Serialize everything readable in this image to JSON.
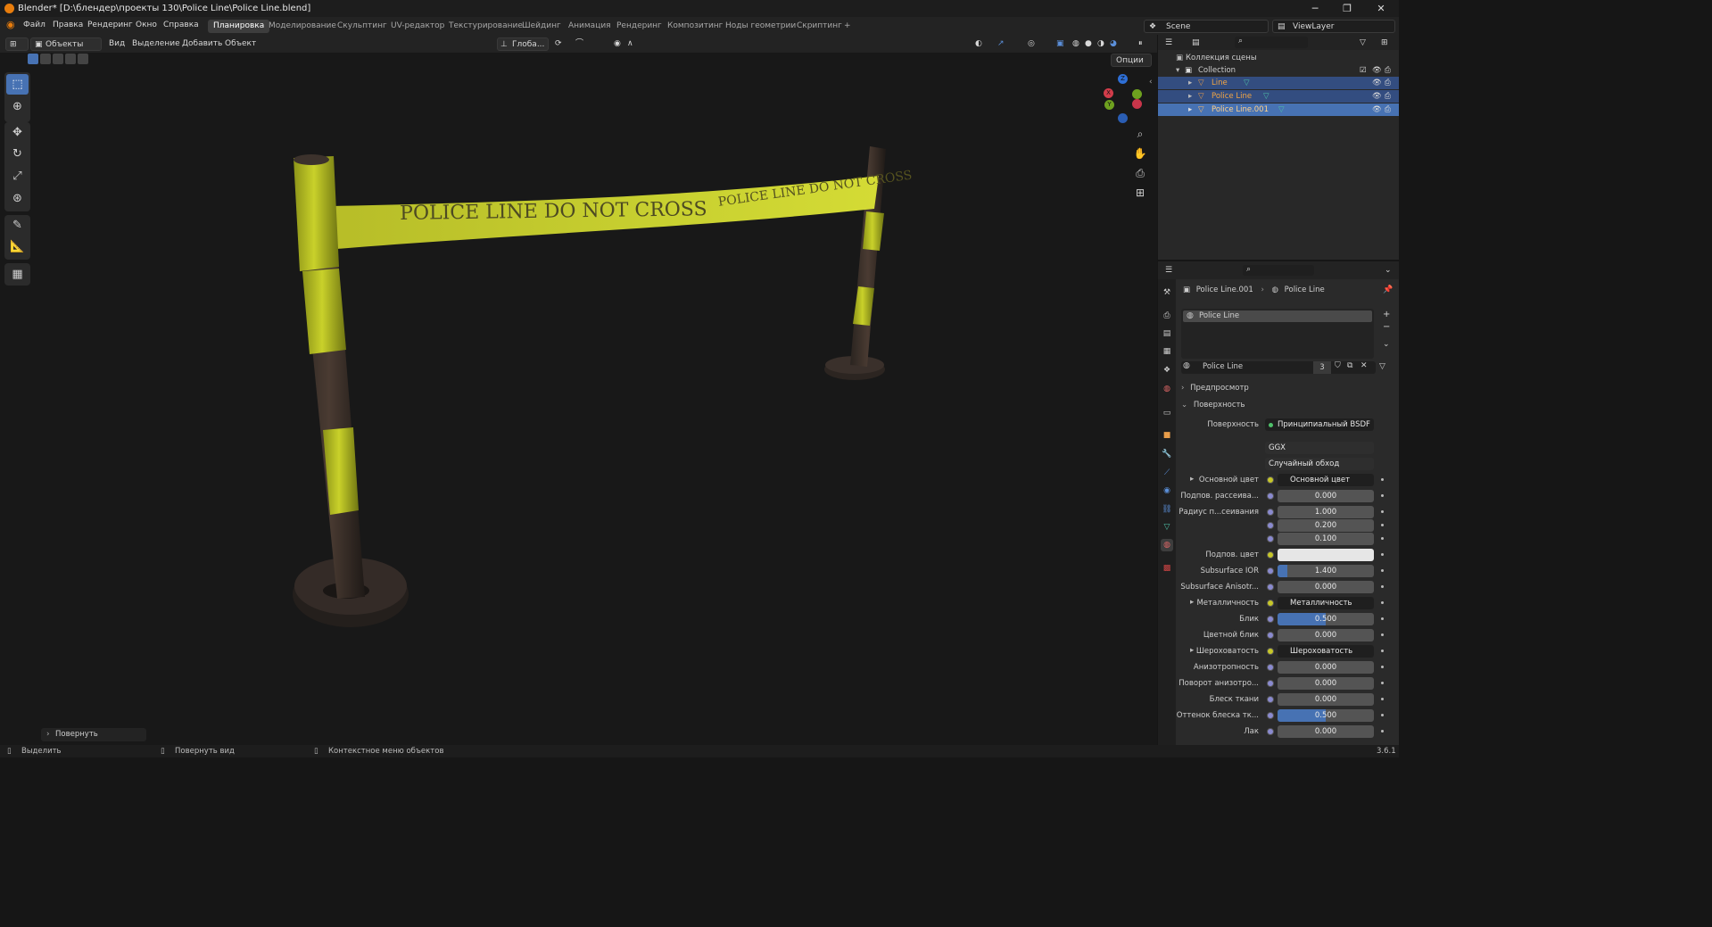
{
  "title": "Blender* [D:\\блендер\\проекты 130\\Police Line\\Police Line.blend]",
  "menu": [
    "Файл",
    "Правка",
    "Рендеринг",
    "Окно",
    "Справка"
  ],
  "workspaces": [
    "Планировка",
    "Моделирование",
    "Скульптинг",
    "UV-редактор",
    "Текстурирование",
    "Шейдинг",
    "Анимация",
    "Рендеринг",
    "Композитинг",
    "Ноды геометрии",
    "Скриптинг"
  ],
  "add_tab": "+",
  "scene_name": "Scene",
  "view_layer": "ViewLayer",
  "viewport_header": {
    "mode": "Объекты",
    "menus": [
      "Вид",
      "Выделение",
      "Добавить",
      "Объект"
    ],
    "orientation": "Глоба...",
    "options": "Опции"
  },
  "scene_text": {
    "tape_main": "POLICE LINE DO NOT CROSS",
    "tape_far": "POLICE LINE DO NOT CROSS"
  },
  "gizmo": {
    "x": "X",
    "y": "Y",
    "z": "Z"
  },
  "operator_panel": "Повернуть",
  "outliner": {
    "root": "Коллекция сцены",
    "collection": "Collection",
    "items": [
      {
        "name": "Line",
        "selected": true
      },
      {
        "name": "Police Line",
        "selected": true
      },
      {
        "name": "Police Line.001",
        "selected": true,
        "active": true
      }
    ]
  },
  "properties": {
    "breadcrumb_object": "Police Line.001",
    "breadcrumb_material": "Police Line",
    "slot_name": "Police Line",
    "material_name": "Police Line",
    "users": "3",
    "sections": {
      "preview": "Предпросмотр",
      "surface": "Поверхность"
    },
    "surface_label": "Поверхность",
    "surface_value": "Принципиальный BSDF",
    "distribution": "GGX",
    "subsurface_method": "Случайный обход",
    "rows": [
      {
        "label": "Основной цвет",
        "value": "Основной цвет",
        "kind": "link",
        "expand": true
      },
      {
        "label": "Подпов. рассеива...",
        "value": "0.000",
        "kind": "num"
      },
      {
        "label": "Радиус п...сеивания",
        "value": "1.000",
        "kind": "num"
      },
      {
        "label": "",
        "value": "0.200",
        "kind": "num"
      },
      {
        "label": "",
        "value": "0.100",
        "kind": "num"
      },
      {
        "label": "Подпов. цвет",
        "value": "",
        "kind": "color"
      },
      {
        "label": "Subsurface IOR",
        "value": "1.400",
        "kind": "num",
        "fill": 0.1
      },
      {
        "label": "Subsurface Anisotr...",
        "value": "0.000",
        "kind": "num"
      },
      {
        "label": "Металличность",
        "value": "Металличность",
        "kind": "link",
        "expand": true
      },
      {
        "label": "Блик",
        "value": "0.500",
        "kind": "num",
        "fill": 0.5
      },
      {
        "label": "Цветной блик",
        "value": "0.000",
        "kind": "num"
      },
      {
        "label": "Шероховатость",
        "value": "Шероховатость",
        "kind": "link",
        "expand": true
      },
      {
        "label": "Анизотропность",
        "value": "0.000",
        "kind": "num"
      },
      {
        "label": "Поворот анизотро...",
        "value": "0.000",
        "kind": "num"
      },
      {
        "label": "Блеск ткани",
        "value": "0.000",
        "kind": "num"
      },
      {
        "label": "Оттенок блеска тк...",
        "value": "0.500",
        "kind": "num",
        "fill": 0.5
      },
      {
        "label": "Лак",
        "value": "0.000",
        "kind": "num"
      }
    ]
  },
  "status": {
    "select": "Выделить",
    "rotate_view": "Повернуть вид",
    "context_menu": "Контекстное меню объектов",
    "version": "3.6.1"
  },
  "colors": {
    "accent": "#4772b3",
    "selection": "#334d80",
    "tape": "#c9d12a",
    "orange": "#e87d0d"
  }
}
